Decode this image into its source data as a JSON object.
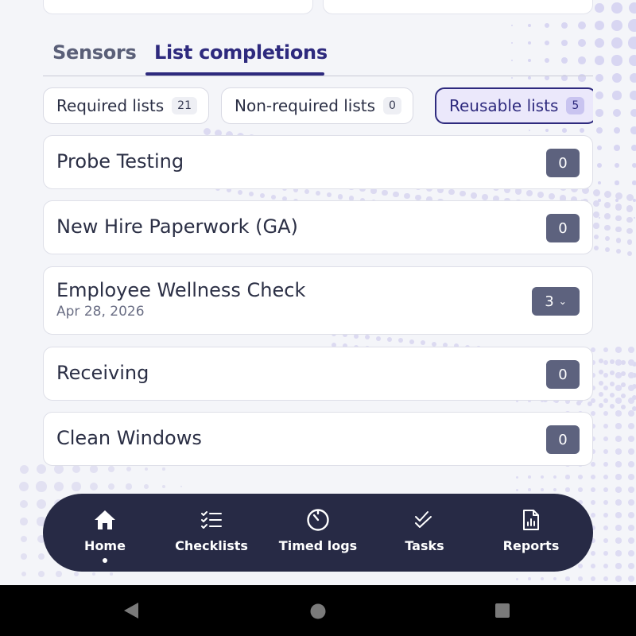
{
  "tabs": [
    {
      "label": "Sensors"
    },
    {
      "label": "List completions"
    }
  ],
  "chips": [
    {
      "label": "Required lists",
      "count": "21"
    },
    {
      "label": "Non-required lists",
      "count": "0"
    },
    {
      "label": "Reusable lists",
      "count": "5"
    }
  ],
  "items": [
    {
      "title": "Probe Testing",
      "count": "0"
    },
    {
      "title": "New Hire Paperwork (GA)",
      "count": "0"
    },
    {
      "title": "Employee Wellness Check",
      "date": "Apr 28, 2026",
      "count": "3"
    },
    {
      "title": "Receiving",
      "count": "0"
    },
    {
      "title": "Clean Windows",
      "count": "0"
    }
  ],
  "nav": [
    {
      "label": "Home",
      "icon": "home-icon"
    },
    {
      "label": "Checklists",
      "icon": "checklist-icon"
    },
    {
      "label": "Timed logs",
      "icon": "timer-icon"
    },
    {
      "label": "Tasks",
      "icon": "double-check-icon"
    },
    {
      "label": "Reports",
      "icon": "report-icon"
    }
  ],
  "colors": {
    "primary": "#2e2a7e",
    "nav_bg": "#272a45",
    "badge_bg": "#5d627e",
    "page_bg": "#f4f5f9"
  }
}
